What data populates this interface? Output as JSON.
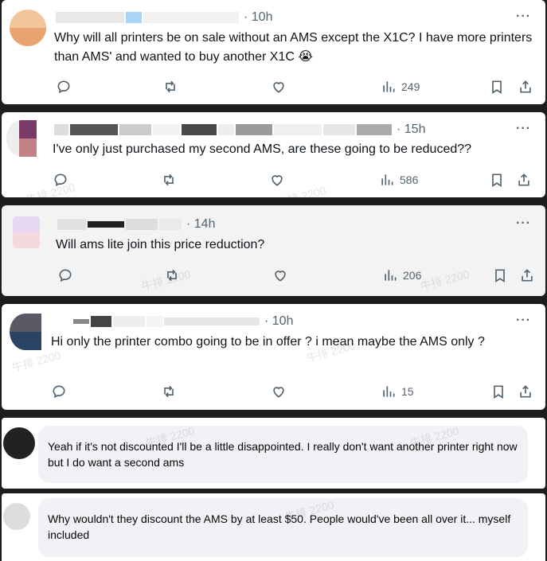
{
  "posts": [
    {
      "time": "· 10h",
      "text": "Why will all printers be on sale without an AMS except the X1C? I have more printers than AMS' and wanted to buy another X1C 😭",
      "views": "249",
      "avatar_colors": [
        "#f3c59b",
        "#e8a36f"
      ]
    },
    {
      "time": "· 15h",
      "text": "I've only just purchased my second AMS, are these going to be reduced??",
      "views": "586",
      "avatar_colors": [
        "#7a3a6a",
        "#c58286"
      ]
    },
    {
      "time": "· 14h",
      "text": "Will ams lite join this price reduction?",
      "views": "206",
      "avatar_colors": [
        "#e8d7f0",
        "#f4d9de"
      ]
    },
    {
      "time": "· 10h",
      "text": "Hi only the printer combo going to be in offer ? i mean maybe the AMS only ?",
      "views": "15",
      "avatar_colors": [
        "#3c3f55",
        "#2b4466"
      ]
    }
  ],
  "replies": [
    {
      "text": "Yeah if it's not discounted I'll be a little disappointed. I really don't want another printer right now but I do want a second ams",
      "avatar_color": "#222222"
    },
    {
      "text": "Why wouldn't they discount the AMS by at least $50. People would've been all over it... myself included",
      "avatar_color": "#dddddd"
    }
  ],
  "more_label": "···",
  "watermark": "牛排 2200"
}
